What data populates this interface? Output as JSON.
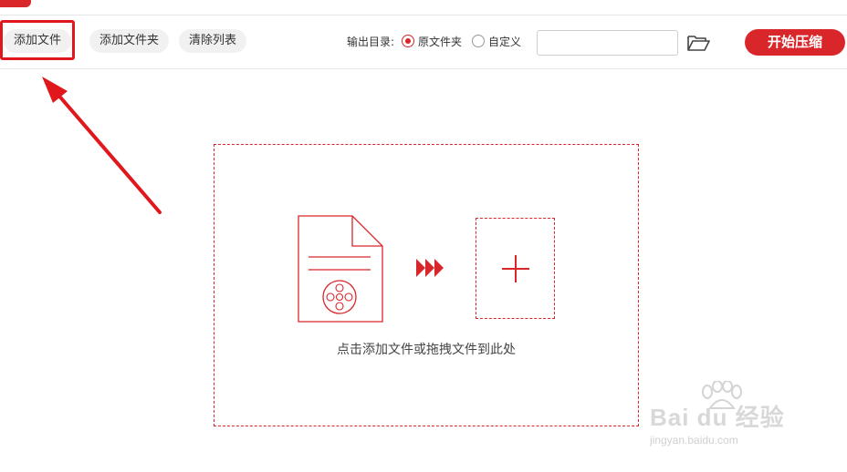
{
  "toolbar": {
    "add_file_label": "添加文件",
    "add_folder_label": "添加文件夹",
    "clear_list_label": "清除列表",
    "output_dir_label": "输出目录:",
    "output_options": [
      {
        "label": "原文件夹",
        "selected": true
      },
      {
        "label": "自定义",
        "selected": false
      }
    ],
    "output_path_value": "",
    "browse_icon": "folder-open-icon",
    "start_label": "开始压缩"
  },
  "drop_zone": {
    "hint": "点击添加文件或拖拽文件到此处",
    "file_icon": "video-file-icon",
    "arrow_icon": "triple-chevron-right-icon",
    "add_icon": "plus-icon"
  },
  "annotation": {
    "highlight": "add-file-button",
    "arrow_color": "#e0171d"
  },
  "watermark": {
    "brand": "Bai du 经验",
    "url": "jingyan.baidu.com"
  },
  "colors": {
    "accent": "#d9262b",
    "button_bg": "#f1f1f1",
    "annotation_red": "#e0171d"
  }
}
